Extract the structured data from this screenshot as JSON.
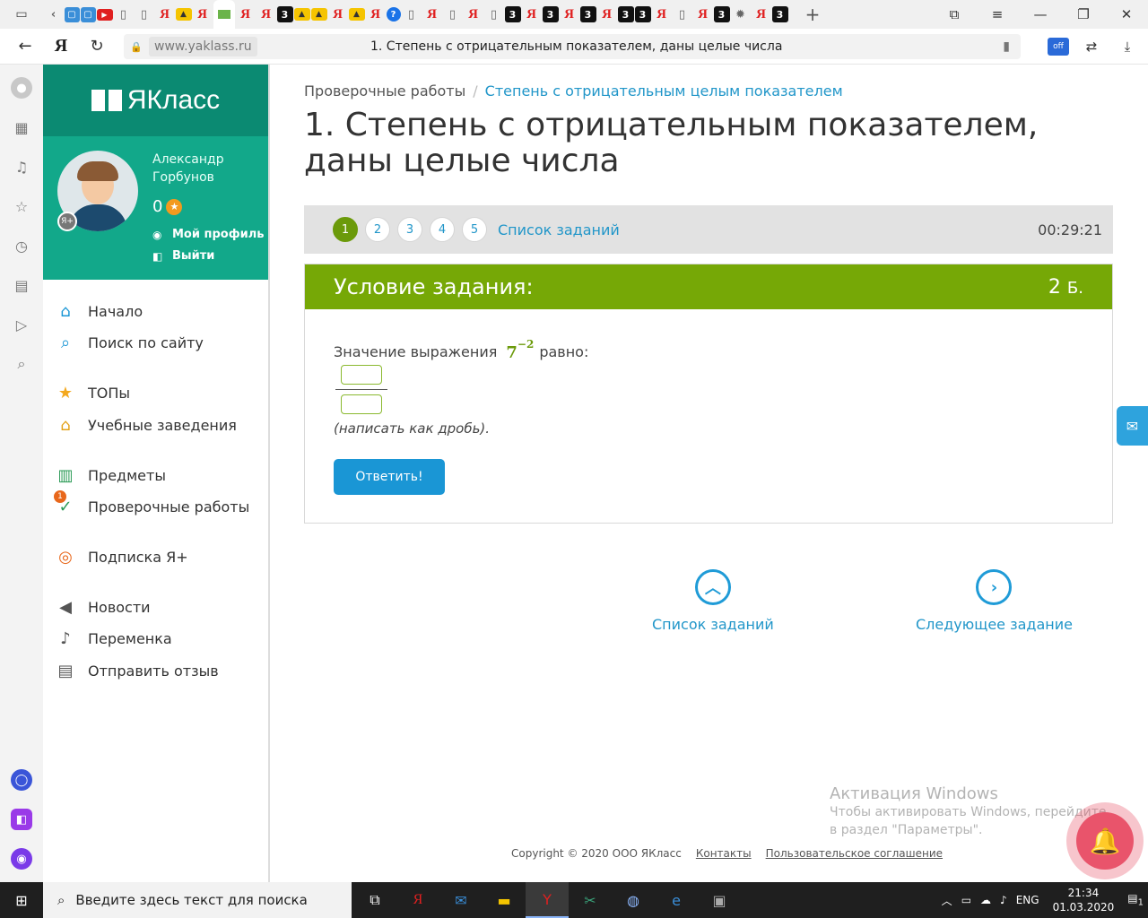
{
  "browser": {
    "url_domain": "www.yaklass.ru",
    "page_title": "1. Степень с отрицательным показателем, даны целые числа"
  },
  "site": {
    "brand": "ЯКласс",
    "user": {
      "name": "Александр Горбунов",
      "points": "0",
      "profile_link": "Мой профиль",
      "logout_link": "Выйти",
      "badge": "Я+"
    },
    "menu": [
      {
        "label": "Начало",
        "icon": "home-icon"
      },
      {
        "label": "Поиск по сайту",
        "icon": "search-icon"
      },
      {
        "label": "ТОПы",
        "icon": "star-icon"
      },
      {
        "label": "Учебные заведения",
        "icon": "institution-icon"
      },
      {
        "label": "Предметы",
        "icon": "books-icon"
      },
      {
        "label": "Проверочные работы",
        "icon": "check-icon",
        "badge": "1"
      },
      {
        "label": "Подписка Я+",
        "icon": "subscription-icon"
      },
      {
        "label": "Новости",
        "icon": "megaphone-icon"
      },
      {
        "label": "Переменка",
        "icon": "bell-icon"
      },
      {
        "label": "Отправить отзыв",
        "icon": "feedback-icon"
      }
    ]
  },
  "breadcrumb": {
    "parent": "Проверочные работы",
    "separator": "/",
    "current": "Степень с отрицательным целым показателем"
  },
  "title": "1. Степень с отрицательным показателем, даны целые числа",
  "task_nav": {
    "numbers": [
      "1",
      "2",
      "3",
      "4",
      "5"
    ],
    "active": "1",
    "list_link": "Список заданий",
    "timer": "00:29:21"
  },
  "task": {
    "header": "Условие задания:",
    "points_value": "2",
    "points_unit": "Б.",
    "prefix": "Значение выражения",
    "base": "7",
    "exponent": "−2",
    "suffix": "равно:",
    "hint": "(написать как дробь).",
    "submit": "Ответить!"
  },
  "bottom_nav": {
    "list": "Список заданий",
    "next": "Следующее задание"
  },
  "watermark": {
    "title": "Активация Windows",
    "text": "Чтобы активировать Windows, перейдите в раздел \"Параметры\"."
  },
  "footer": {
    "copyright": "Copyright © 2020 ООО ЯКласс",
    "contacts": "Контакты",
    "agreement": "Пользовательское соглашение"
  },
  "taskbar": {
    "search_placeholder": "Введите здесь текст для поиска",
    "lang": "ENG",
    "time": "21:34",
    "date": "01.03.2020",
    "notifications": "1"
  }
}
